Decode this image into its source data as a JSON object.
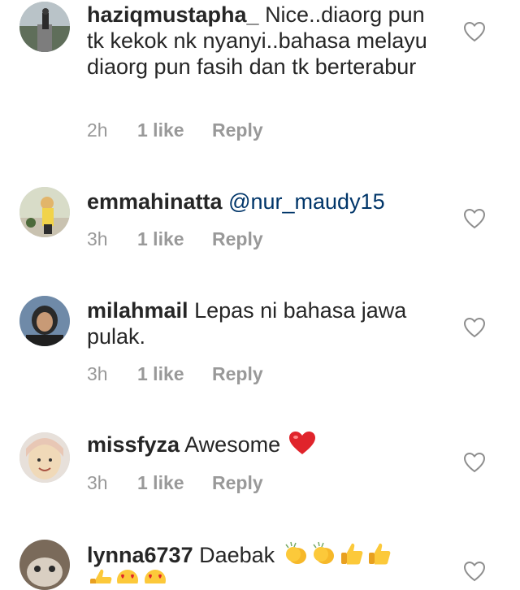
{
  "comments": [
    {
      "username": "haziqmustapha_",
      "text": "Nice..diaorg pun tk kekok nk nyanyi..bahasa melayu diaorg pun fasih dan tk berterabur",
      "time": "2h",
      "likes": "1 like",
      "reply": "Reply"
    },
    {
      "username": "emmahinatta",
      "mention": "@nur_maudy15",
      "time": "3h",
      "likes": "1 like",
      "reply": "Reply"
    },
    {
      "username": "milahmail",
      "text": "Lepas ni bahasa jawa pulak.",
      "time": "3h",
      "likes": "1 like",
      "reply": "Reply"
    },
    {
      "username": "missfyza",
      "text": "Awesome",
      "emoji": "red-heart",
      "time": "3h",
      "likes": "1 like",
      "reply": "Reply"
    },
    {
      "username": "lynna6737",
      "text": "Daebak",
      "emoji": [
        "clapping-hands",
        "clapping-hands",
        "thumbs-up",
        "thumbs-up",
        "thumbs-up",
        "heart-eyes-face",
        "heart-eyes-face"
      ]
    }
  ],
  "icons": {
    "like": "heart-outline-icon"
  },
  "colors": {
    "text": "#262626",
    "meta": "#999999",
    "mention": "#003569",
    "heart_outline": "#8e8e8e"
  }
}
